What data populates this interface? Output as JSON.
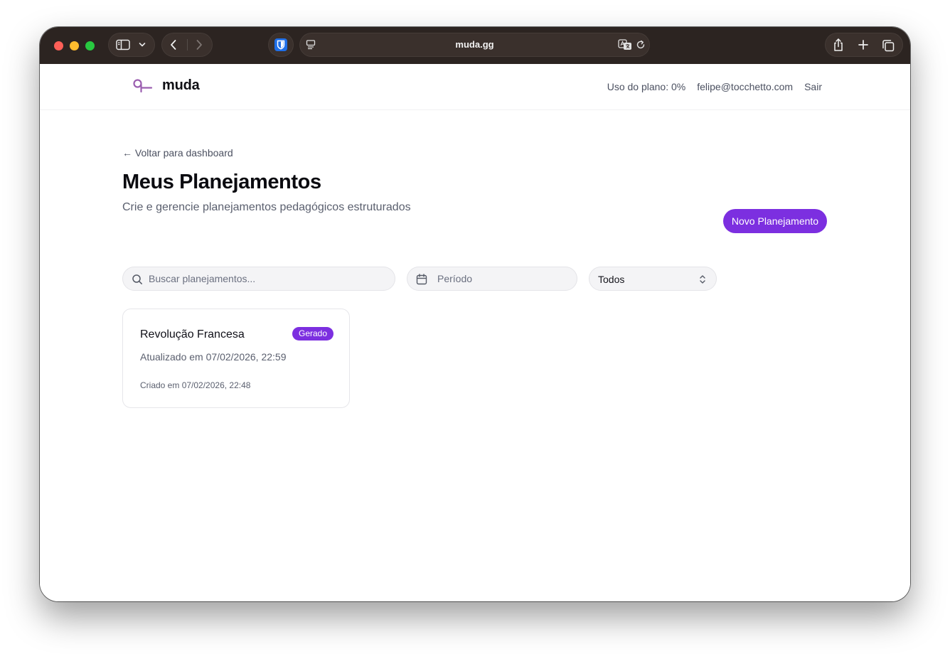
{
  "browser": {
    "url": "muda.gg",
    "icons": {
      "sidebar": "sidebar-icon",
      "dropdown": "chevron-down-icon",
      "back": "chevron-left-icon",
      "forward": "chevron-right-icon",
      "password_manager": "bitwarden-icon",
      "reader": "page-menu-icon",
      "translate": "translate-icon",
      "reload": "reload-icon",
      "share": "share-icon",
      "new_tab": "plus-icon",
      "tab_overview": "tabs-icon"
    }
  },
  "header": {
    "brand": "muda",
    "plan_usage": "Uso do plano: 0%",
    "user_email": "felipe@tocchetto.com",
    "logout_label": "Sair"
  },
  "main": {
    "back_link": "← Voltar para dashboard",
    "title": "Meus Planejamentos",
    "subtitle": "Crie e gerencie planejamentos pedagógicos estruturados",
    "new_button_label": "Novo Planejamento",
    "filters": {
      "search_placeholder": "Buscar planejamentos...",
      "period_placeholder": "Período",
      "status_selected": "Todos"
    },
    "plans": [
      {
        "title": "Revolução Francesa",
        "status": "Gerado",
        "updated": "Atualizado em 07/02/2026, 22:59",
        "created": "Criado em 07/02/2026, 22:48"
      }
    ]
  },
  "colors": {
    "accent": "#7c2fe0",
    "chrome": "#2c2421",
    "logo": "#9b5fb0"
  }
}
